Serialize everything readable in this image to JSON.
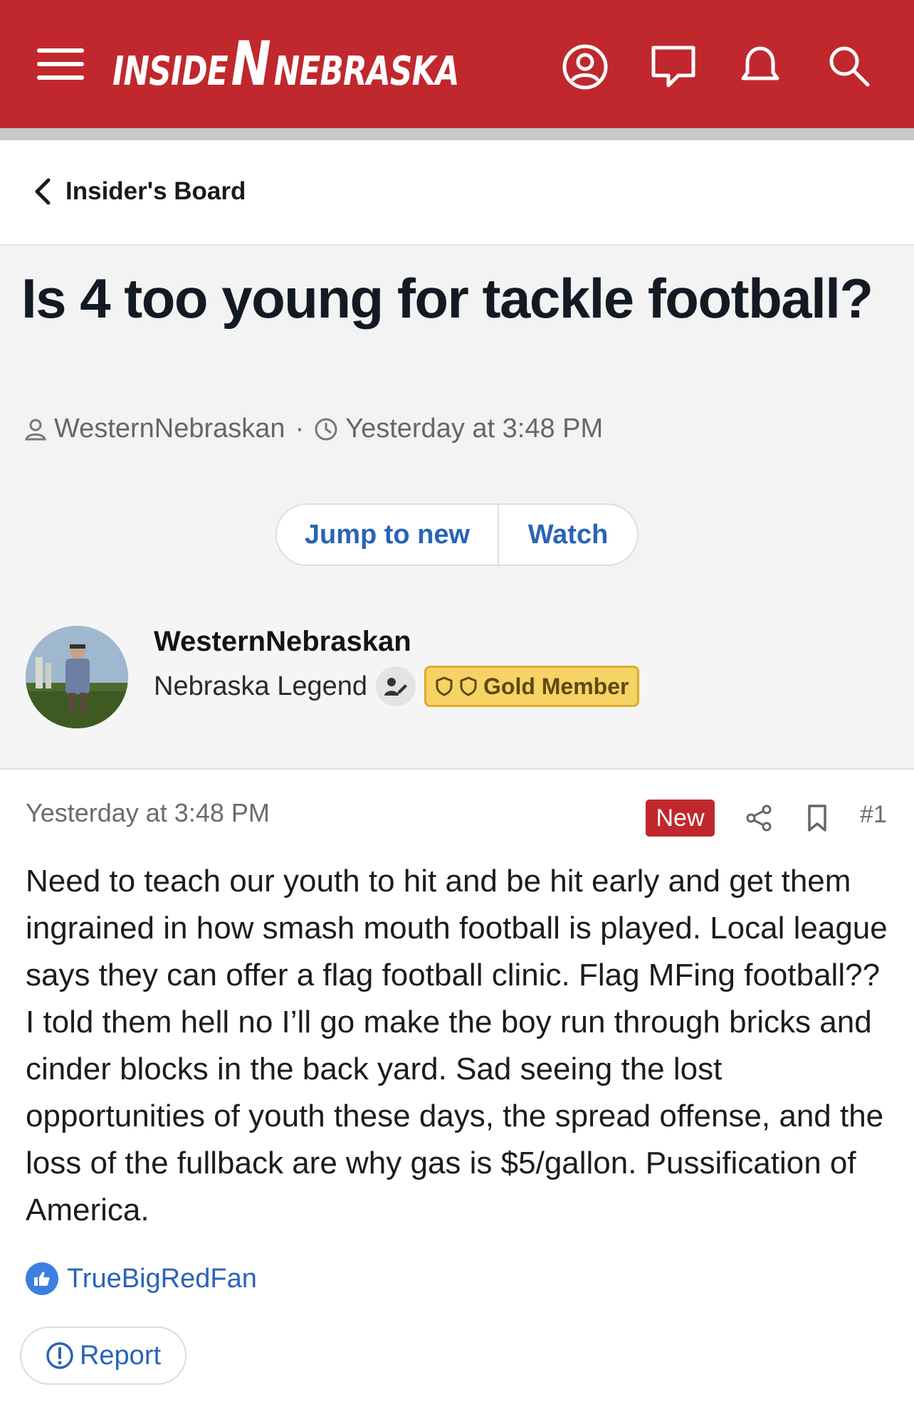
{
  "header": {
    "logo_left": "INSIDE",
    "logo_mark": "N",
    "logo_right": "NEBRASKA",
    "icons": [
      "menu-icon",
      "account-icon",
      "chat-icon",
      "bell-icon",
      "search-icon"
    ],
    "brand_color": "#c0282d"
  },
  "breadcrumb": {
    "back_label": "Insider's Board"
  },
  "thread": {
    "title": "Is 4 too young for tackle football?",
    "author": "WesternNebraskan",
    "separator": "·",
    "time": "Yesterday at 3:48 PM",
    "jump_label": "Jump to new",
    "watch_label": "Watch"
  },
  "user": {
    "name": "WesternNebraskan",
    "rank": "Nebraska Legend",
    "badge": "Gold Member"
  },
  "post": {
    "time": "Yesterday at 3:48 PM",
    "new_label": "New",
    "number": "#1",
    "body": "Need to teach our youth to hit and be hit early and get them ingrained in how smash mouth football is played. Local league says they can offer a flag football clinic. Flag MFing football?? I told them hell no I’ll go make the boy run through bricks and cinder blocks in the back yard. Sad seeing the lost opportunities of youth these days, the spread offense, and the loss of the fullback are why gas is $5/gallon. Pussification of America.",
    "liked_by": "TrueBigRedFan",
    "report_label": "Report"
  }
}
